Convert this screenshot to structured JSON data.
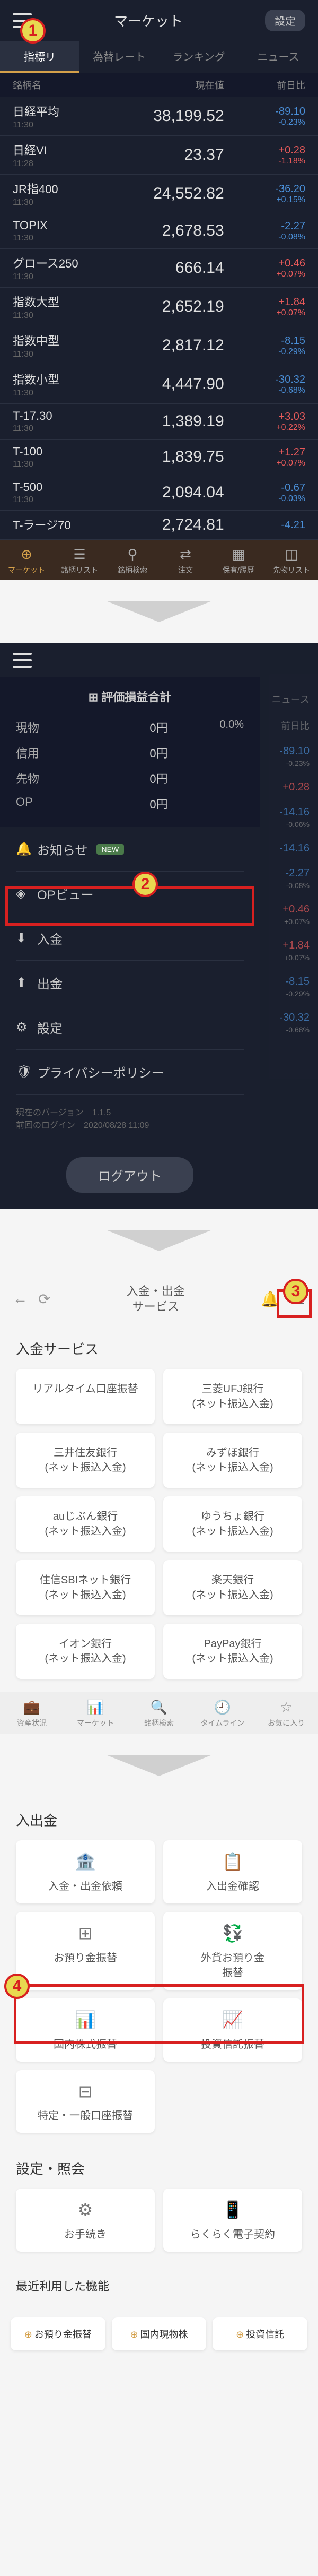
{
  "screen1": {
    "title": "マーケット",
    "settings": "設定",
    "tabs": [
      "指標リ",
      "為替レート",
      "ランキング",
      "ニュース"
    ],
    "active_tab": 0,
    "cols": [
      "銘柄名",
      "現在値",
      "前日比"
    ],
    "rows": [
      {
        "name": "日経平均",
        "time": "11:30",
        "price": "38,199.52",
        "d1": "-89.10",
        "d2": "-0.23%",
        "cls": "neg"
      },
      {
        "name": "日経VI",
        "time": "11:28",
        "price": "23.37",
        "d1": "+0.28",
        "d2": "-1.18%",
        "cls": "pos"
      },
      {
        "name": "JR指400",
        "time": "11:30",
        "price": "24,552.82",
        "d1": "-36.20",
        "d2": "+0.15%",
        "cls": "neg"
      },
      {
        "name": "TOPIX",
        "time": "11:30",
        "price": "2,678.53",
        "d1": "-2.27",
        "d2": "-0.08%",
        "cls": "neg"
      },
      {
        "name": "グロース250",
        "time": "11:30",
        "price": "666.14",
        "d1": "+0.46",
        "d2": "+0.07%",
        "cls": "pos"
      },
      {
        "name": "指数大型",
        "time": "11:30",
        "price": "2,652.19",
        "d1": "+1.84",
        "d2": "+0.07%",
        "cls": "pos"
      },
      {
        "name": "指数中型",
        "time": "11:30",
        "price": "2,817.12",
        "d1": "-8.15",
        "d2": "-0.29%",
        "cls": "neg"
      },
      {
        "name": "指数小型",
        "time": "11:30",
        "price": "4,447.90",
        "d1": "-30.32",
        "d2": "-0.68%",
        "cls": "neg"
      },
      {
        "name": "T-17.30",
        "time": "11:30",
        "price": "1,389.19",
        "d1": "+3.03",
        "d2": "+0.22%",
        "cls": "pos"
      },
      {
        "name": "T-100",
        "time": "11:30",
        "price": "1,839.75",
        "d1": "+1.27",
        "d2": "+0.07%",
        "cls": "pos"
      },
      {
        "name": "T-500",
        "time": "11:30",
        "price": "2,094.04",
        "d1": "-0.67",
        "d2": "-0.03%",
        "cls": "neg"
      },
      {
        "name": "T-ラージ70",
        "time": "",
        "price": "2,724.81",
        "d1": "-4.21",
        "d2": "",
        "cls": "neg"
      }
    ],
    "bottom": [
      "マーケット",
      "銘柄リスト",
      "銘柄検索",
      "注文",
      "保有/履歴",
      "先物リスト"
    ]
  },
  "screen2": {
    "summary_title": "評価損益合計",
    "summary": [
      {
        "label": "現物",
        "value": "0円",
        "pct": "0.0%"
      },
      {
        "label": "信用",
        "value": "0円",
        "pct": ""
      },
      {
        "label": "先物",
        "value": "0円",
        "pct": ""
      },
      {
        "label": "OP",
        "value": "0円",
        "pct": ""
      }
    ],
    "menu": [
      {
        "icon": "🔔",
        "label": "お知らせ",
        "new": true
      },
      {
        "icon": "◈",
        "label": "OPビュー",
        "new": false
      },
      {
        "icon": "⬇",
        "label": "入金",
        "new": false
      },
      {
        "icon": "⬆",
        "label": "出金",
        "new": false
      },
      {
        "icon": "⚙",
        "label": "設定",
        "new": false
      },
      {
        "icon": "🛡",
        "label": "プライバシーポリシー",
        "new": false
      }
    ],
    "version_label": "現在のバージョン",
    "version": "1.1.5",
    "login_label": "前回のログイン",
    "login": "2020/08/28 11:09",
    "logout": "ログアウト",
    "side_tabs": [
      "ニュース",
      "前日比"
    ],
    "side": [
      {
        "v": "-89.10",
        "p": "-0.23%",
        "cls": "neg"
      },
      {
        "v": "+0.28",
        "p": "",
        "cls": "pos"
      },
      {
        "v": "-14.16",
        "p": "-0.06%",
        "cls": "neg"
      },
      {
        "v": "-14.16",
        "p": "",
        "cls": "neg"
      },
      {
        "v": "-2.27",
        "p": "-0.08%",
        "cls": "neg"
      },
      {
        "v": "+0.46",
        "p": "+0.07%",
        "cls": "pos"
      },
      {
        "v": "+1.84",
        "p": "+0.07%",
        "cls": "pos"
      },
      {
        "v": "-8.15",
        "p": "-0.29%",
        "cls": "neg"
      },
      {
        "v": "-30.32",
        "p": "-0.68%",
        "cls": "neg"
      }
    ]
  },
  "screen3": {
    "title": "入金・出金\nサービス",
    "section": "入金サービス",
    "cards": [
      "リアルタイム口座振替",
      "三菱UFJ銀行\n(ネット振込入金)",
      "三井住友銀行\n(ネット振込入金)",
      "みずほ銀行\n(ネット振込入金)",
      "auじぶん銀行\n(ネット振込入金)",
      "ゆうちょ銀行\n(ネット振込入金)",
      "住信SBIネット銀行\n(ネット振込入金)",
      "楽天銀行\n(ネット振込入金)",
      "イオン銀行\n(ネット振込入金)",
      "PayPay銀行\n(ネット振込入金)"
    ],
    "bottom": [
      "資産状況",
      "マーケット",
      "銘柄検索",
      "タイムライン",
      "お気に入り"
    ]
  },
  "screen4": {
    "section1": "入出金",
    "cards1": [
      {
        "icon": "🏦",
        "label": "入金・出金依頼"
      },
      {
        "icon": "📋",
        "label": "入出金確認"
      },
      {
        "icon": "⊞",
        "label": "お預り金振替"
      },
      {
        "icon": "💱",
        "label": "外貨お預り金\n振替"
      },
      {
        "icon": "📊",
        "label": "国内株式振替"
      },
      {
        "icon": "📈",
        "label": "投資信託振替"
      },
      {
        "icon": "⊟",
        "label": "特定・一般口座振替"
      }
    ],
    "section2": "設定・照会",
    "cards2": [
      {
        "icon": "⚙",
        "label": "お手続き"
      },
      {
        "icon": "📱",
        "label": "らくらく電子契約"
      }
    ],
    "recent_title": "最近利用した機能",
    "recent": [
      "お預り金振替",
      "国内現物株",
      "投資信託"
    ]
  }
}
